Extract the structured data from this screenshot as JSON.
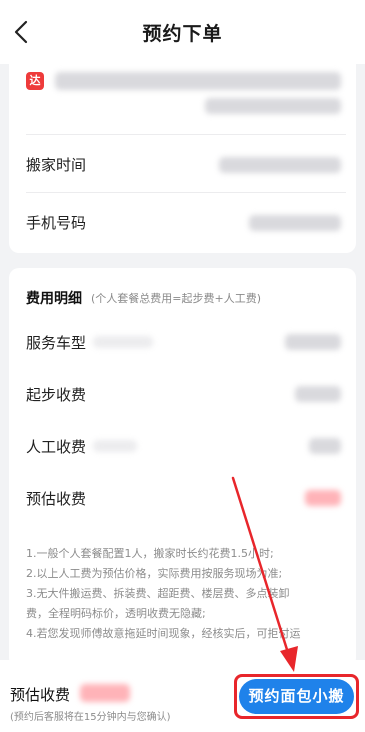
{
  "header": {
    "title": "预约下单"
  },
  "order": {
    "badge": "达",
    "move_time_label": "搬家时间",
    "phone_label": "手机号码"
  },
  "fees": {
    "title": "费用明细",
    "subtitle": "(个人套餐总费用=起步费+人工费)",
    "rows": [
      {
        "label": "服务车型"
      },
      {
        "label": "起步收费"
      },
      {
        "label": "人工收费"
      },
      {
        "label": "预估收费"
      }
    ],
    "notes": [
      "1.一般个人套餐配置1人，搬家时长约花费1.5小时;",
      "2.以上人工费为预估价格，实际费用按服务现场为准;",
      "3.无大件搬运费、拆装费、超距费、楼层费、多点装卸",
      "费，全程明码标价，透明收费无隐藏;",
      "4.若您发现师傅故意拖延时间现象，经核实后，可拒付运"
    ]
  },
  "bottom_bar": {
    "estimate_label": "预估收费",
    "note": "(预约后客服将在15分钟内与您确认)",
    "book_button": "预约面包小搬"
  },
  "colors": {
    "primary_blue": "#1f82ea",
    "highlight_red": "#e8262b",
    "badge_red": "#ee3b3b"
  }
}
